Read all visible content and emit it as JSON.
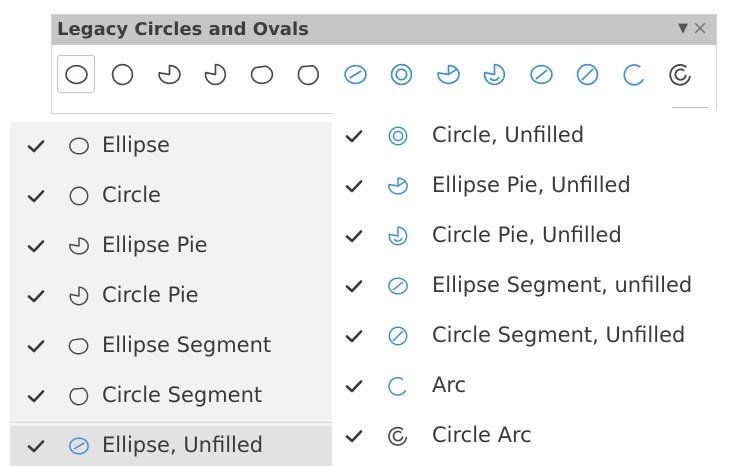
{
  "toolbar": {
    "title": "Legacy Circles and Ovals",
    "menu_icon": "dropdown-triangle-icon",
    "close_icon": "close-icon",
    "buttons": [
      {
        "name": "ellipse",
        "icon": "ellipse-icon",
        "selected": true
      },
      {
        "name": "circle",
        "icon": "circle-icon"
      },
      {
        "name": "ellipse-pie",
        "icon": "ellipse-pie-icon"
      },
      {
        "name": "circle-pie",
        "icon": "circle-pie-icon"
      },
      {
        "name": "ellipse-segment",
        "icon": "ellipse-segment-icon"
      },
      {
        "name": "circle-segment",
        "icon": "circle-segment-icon"
      },
      {
        "name": "ellipse-unfilled",
        "icon": "ellipse-unfilled-icon"
      },
      {
        "name": "circle-unfilled",
        "icon": "circle-unfilled-icon"
      },
      {
        "name": "ellipse-pie-unfilled",
        "icon": "ellipse-pie-unfilled-icon"
      },
      {
        "name": "circle-pie-unfilled",
        "icon": "circle-pie-unfilled-icon"
      },
      {
        "name": "ellipse-segment-unfilled",
        "icon": "ellipse-segment-unfilled-icon"
      },
      {
        "name": "circle-segment-unfilled",
        "icon": "circle-segment-unfilled-icon"
      },
      {
        "name": "arc",
        "icon": "arc-icon"
      },
      {
        "name": "circle-arc",
        "icon": "circle-arc-icon"
      }
    ]
  },
  "menu_left": {
    "items": [
      {
        "label": "Ellipse",
        "icon": "ellipse-icon",
        "checked": true
      },
      {
        "label": "Circle",
        "icon": "circle-icon",
        "checked": true
      },
      {
        "label": "Ellipse Pie",
        "icon": "ellipse-pie-icon",
        "checked": true
      },
      {
        "label": "Circle Pie",
        "icon": "circle-pie-icon",
        "checked": true
      },
      {
        "label": "Ellipse Segment",
        "icon": "ellipse-segment-icon",
        "checked": true
      },
      {
        "label": "Circle Segment",
        "icon": "circle-segment-icon",
        "checked": true
      },
      {
        "label": "Ellipse, Unfilled",
        "icon": "ellipse-unfilled-icon",
        "checked": true,
        "highlighted": true
      }
    ]
  },
  "menu_right": {
    "items": [
      {
        "label": "Circle, Unfilled",
        "icon": "circle-unfilled-icon",
        "checked": true
      },
      {
        "label": "Ellipse Pie, Unfilled",
        "icon": "ellipse-pie-unfilled-icon",
        "checked": true
      },
      {
        "label": "Circle Pie, Unfilled",
        "icon": "circle-pie-unfilled-icon",
        "checked": true
      },
      {
        "label": "Ellipse Segment, unfilled",
        "icon": "ellipse-segment-unfilled-icon",
        "checked": true
      },
      {
        "label": "Circle Segment, Unfilled",
        "icon": "circle-segment-unfilled-icon",
        "checked": true
      },
      {
        "label": "Arc",
        "icon": "arc-icon",
        "checked": true
      },
      {
        "label": "Circle Arc",
        "icon": "circle-arc-icon",
        "checked": true
      }
    ]
  },
  "colors": {
    "icon_gray": "#4a4a4a",
    "icon_blue": "#3c8fd6",
    "titlebar": "#c6c6c6",
    "highlight": "#e2e2e2",
    "check": "#3a3a3a"
  }
}
